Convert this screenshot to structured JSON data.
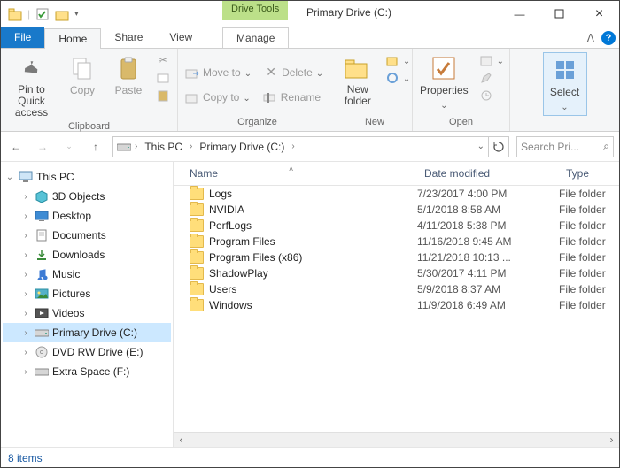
{
  "titlebar": {
    "tools_context": "Drive Tools",
    "title": "Primary Drive (C:)"
  },
  "tabs": {
    "file": "File",
    "home": "Home",
    "share": "Share",
    "view": "View",
    "manage": "Manage"
  },
  "ribbon": {
    "pin": "Pin to Quick\naccess",
    "copy": "Copy",
    "paste": "Paste",
    "clipboard": "Clipboard",
    "moveto": "Move to",
    "copyto": "Copy to",
    "delete": "Delete",
    "rename": "Rename",
    "organize": "Organize",
    "newfolder": "New\nfolder",
    "new": "New",
    "properties": "Properties",
    "open": "Open",
    "select": "Select"
  },
  "address": {
    "this_pc": "This PC",
    "current": "Primary Drive (C:)",
    "search_placeholder": "Search Pri..."
  },
  "tree": {
    "this_pc": "This PC",
    "items": [
      {
        "label": "3D Objects"
      },
      {
        "label": "Desktop"
      },
      {
        "label": "Documents"
      },
      {
        "label": "Downloads"
      },
      {
        "label": "Music"
      },
      {
        "label": "Pictures"
      },
      {
        "label": "Videos"
      },
      {
        "label": "Primary Drive (C:)"
      },
      {
        "label": "DVD RW Drive (E:)"
      },
      {
        "label": "Extra Space (F:)"
      }
    ]
  },
  "columns": {
    "name": "Name",
    "date": "Date modified",
    "type": "Type"
  },
  "rows": [
    {
      "name": "Logs",
      "date": "7/23/2017 4:00 PM",
      "type": "File folder"
    },
    {
      "name": "NVIDIA",
      "date": "5/1/2018 8:58 AM",
      "type": "File folder"
    },
    {
      "name": "PerfLogs",
      "date": "4/11/2018 5:38 PM",
      "type": "File folder"
    },
    {
      "name": "Program Files",
      "date": "11/16/2018 9:45 AM",
      "type": "File folder"
    },
    {
      "name": "Program Files (x86)",
      "date": "11/21/2018 10:13 ...",
      "type": "File folder"
    },
    {
      "name": "ShadowPlay",
      "date": "5/30/2017 4:11 PM",
      "type": "File folder"
    },
    {
      "name": "Users",
      "date": "5/9/2018 8:37 AM",
      "type": "File folder"
    },
    {
      "name": "Windows",
      "date": "11/9/2018 6:49 AM",
      "type": "File folder"
    }
  ],
  "status": {
    "count": "8 items"
  }
}
